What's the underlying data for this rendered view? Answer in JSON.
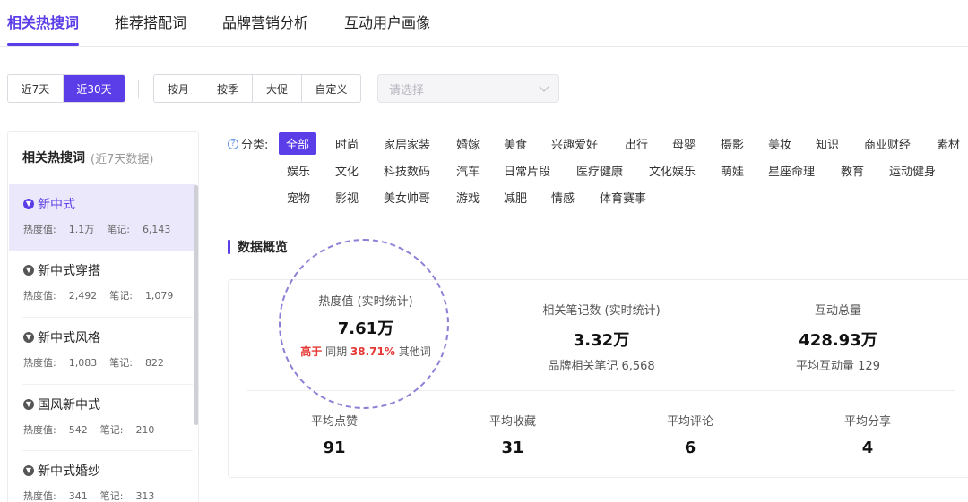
{
  "tabs": [
    {
      "label": "相关热搜词",
      "active": true
    },
    {
      "label": "推荐搭配词",
      "active": false
    },
    {
      "label": "品牌营销分析",
      "active": false
    },
    {
      "label": "互动用户画像",
      "active": false
    }
  ],
  "filters": {
    "range": [
      "近7天",
      "近30天"
    ],
    "range_selected": "近30天",
    "period": [
      "按月",
      "按季",
      "大促",
      "自定义"
    ],
    "select_placeholder": "请选择"
  },
  "sidebar": {
    "title": "相关热搜词",
    "subtitle": "(近7天数据)",
    "heat_label": "热度值:",
    "notes_label": "笔记:",
    "items": [
      {
        "name": "新中式",
        "heat": "1.1万",
        "notes": "6,143",
        "active": true
      },
      {
        "name": "新中式穿搭",
        "heat": "2,492",
        "notes": "1,079",
        "active": false
      },
      {
        "name": "新中式风格",
        "heat": "1,083",
        "notes": "822",
        "active": false
      },
      {
        "name": "国风新中式",
        "heat": "542",
        "notes": "210",
        "active": false
      },
      {
        "name": "新中式婚纱",
        "heat": "341",
        "notes": "313",
        "active": false
      }
    ]
  },
  "categories": {
    "label": "分类:",
    "items": [
      "全部",
      "时尚",
      "家居家装",
      "婚嫁",
      "美食",
      "兴趣爱好",
      "出行",
      "母婴",
      "摄影",
      "美妆",
      "知识",
      "商业财经",
      "素材",
      "娱乐",
      "文化",
      "科技数码",
      "汽车",
      "日常片段",
      "医疗健康",
      "文化娱乐",
      "萌娃",
      "星座命理",
      "教育",
      "运动健身",
      "宠物",
      "影视",
      "美女帅哥",
      "游戏",
      "减肥",
      "情感",
      "体育赛事"
    ],
    "selected": "全部"
  },
  "overview": {
    "title": "数据概览",
    "heat": {
      "label": "热度值 (实时统计)",
      "value": "7.61万",
      "compare_prefix": "高于",
      "compare_mid": "同期",
      "compare_pct": "38.71%",
      "compare_suffix": "其他词"
    },
    "notes": {
      "label": "相关笔记数 (实时统计)",
      "value": "3.32万",
      "sub": "品牌相关笔记 6,568"
    },
    "interactions": {
      "label": "互动总量",
      "value": "428.93万",
      "sub": "平均互动量 129"
    },
    "avg_likes": {
      "label": "平均点赞",
      "value": "91"
    },
    "avg_collects": {
      "label": "平均收藏",
      "value": "31"
    },
    "avg_comments": {
      "label": "平均评论",
      "value": "6"
    },
    "avg_shares": {
      "label": "平均分享",
      "value": "4"
    }
  },
  "colors": {
    "accent": "#5b3ee8",
    "highlight": "#e53935",
    "ring": "#8e7fd6"
  }
}
